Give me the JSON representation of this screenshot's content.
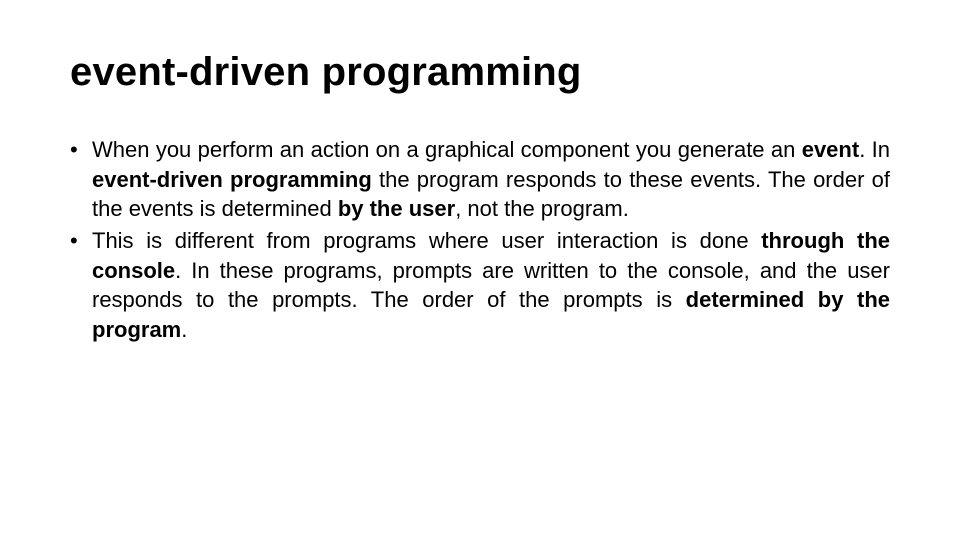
{
  "title": "event-driven programming",
  "bullets": [
    {
      "runs": [
        {
          "t": "When you perform an action on a graphical component you generate an ",
          "b": false
        },
        {
          "t": "event",
          "b": true
        },
        {
          "t": ". In ",
          "b": false
        },
        {
          "t": "event-driven programming",
          "b": true
        },
        {
          "t": " the program responds to these events. The order of the events is determined ",
          "b": false
        },
        {
          "t": "by the user",
          "b": true
        },
        {
          "t": ", not the program.",
          "b": false
        }
      ]
    },
    {
      "runs": [
        {
          "t": "This is different from programs where user interaction is done ",
          "b": false
        },
        {
          "t": "through the console",
          "b": true
        },
        {
          "t": ". In these programs, prompts are written to the console, and the user responds to the prompts. The order of the prompts is ",
          "b": false
        },
        {
          "t": "determined by the program",
          "b": true
        },
        {
          "t": ".",
          "b": false
        }
      ]
    }
  ]
}
